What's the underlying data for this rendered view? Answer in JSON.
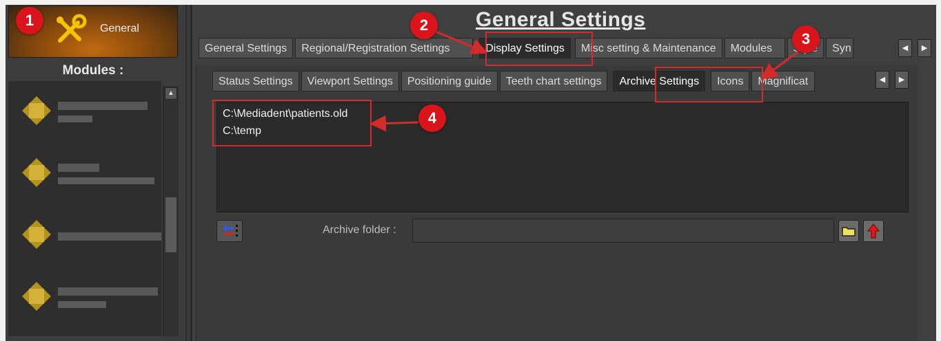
{
  "left": {
    "general_label": "General",
    "modules_title": "Modules :"
  },
  "main": {
    "title": "General Settings",
    "main_tabs": {
      "general_settings": "General Settings",
      "regional": "Regional/Registration Settings",
      "display": "Display Settings",
      "misc": "Misc setting & Maintenance",
      "modules": "Modules",
      "style": "Style",
      "sync": "Syn"
    },
    "sub_tabs": {
      "status": "Status Settings",
      "viewport": "Viewport Settings",
      "positioning": "Positioning guide",
      "teeth": "Teeth chart settings",
      "archive": "Archive Settings",
      "icons": "Icons",
      "magnification": "Magnificat"
    },
    "archive_paths": [
      "C:\\Mediadent\\patients.old",
      "C:\\temp"
    ],
    "archive_folder_label": "Archive folder :",
    "archive_folder_value": ""
  },
  "annotations": [
    "1",
    "2",
    "3",
    "4"
  ],
  "colors": {
    "annotation_red": "#d9151b",
    "active_tab_bg": "#2b2b2b",
    "general_orange": "#c06a10"
  }
}
